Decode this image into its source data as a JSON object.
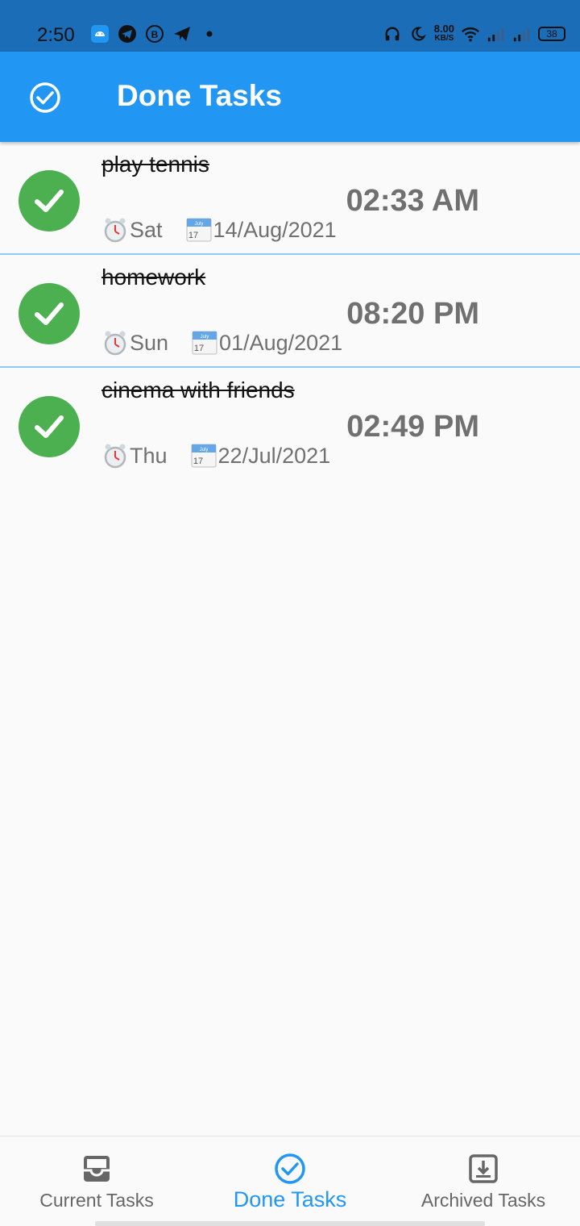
{
  "status_bar": {
    "time": "2:50",
    "net_speed": "8.00",
    "net_unit": "KB/S",
    "battery": "38"
  },
  "app_bar": {
    "title": "Done Tasks",
    "icon": "check-circle-outline-icon"
  },
  "tasks": [
    {
      "title": "play tennis",
      "time": "02:33 AM",
      "day": "Sat",
      "date": "14/Aug/2021",
      "status_icon": "check-icon"
    },
    {
      "title": "homework ",
      "time": "08:20 PM",
      "day": "Sun",
      "date": "01/Aug/2021",
      "status_icon": "check-icon"
    },
    {
      "title": "cinema with friends ",
      "time": "02:49 PM",
      "day": "Thu",
      "date": "22/Jul/2021",
      "status_icon": "check-icon"
    }
  ],
  "bottom_nav": {
    "items": [
      {
        "label": "Current Tasks",
        "icon": "inbox-icon",
        "active": false
      },
      {
        "label": "Done Tasks",
        "icon": "check-circle-outline-icon",
        "active": true
      },
      {
        "label": "Archived Tasks",
        "icon": "archive-icon",
        "active": false
      }
    ]
  },
  "colors": {
    "status_bar": "#1c6db8",
    "app_bar": "#2196f3",
    "done_check": "#4caf50",
    "divider": "#90caf9",
    "muted_text": "#707070"
  }
}
